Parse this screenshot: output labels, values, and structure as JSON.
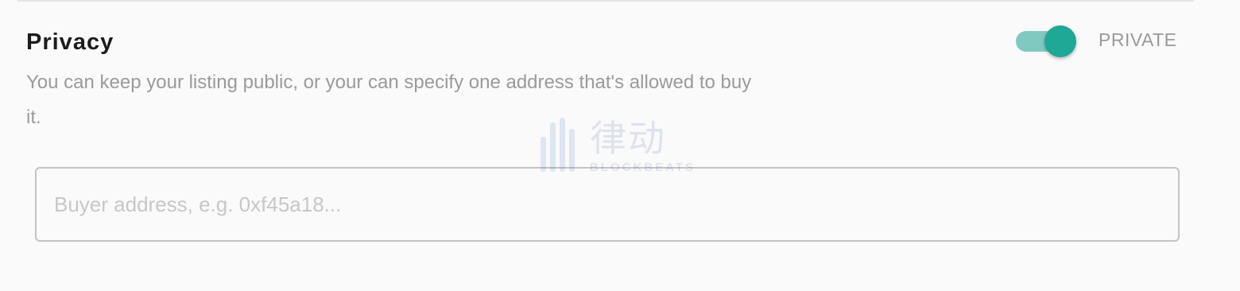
{
  "privacy": {
    "title": "Privacy",
    "description": "You can keep your listing public, or your can specify one address that's allowed to buy it.",
    "toggle": {
      "label": "PRIVATE",
      "on": true,
      "track_color": "#80c9c0",
      "knob_color": "#1ea896"
    },
    "buyer_address": {
      "value": "",
      "placeholder": "Buyer address, e.g. 0xf45a18..."
    }
  },
  "watermark": {
    "chinese": "律动",
    "english": "BLOCKBEATS"
  }
}
